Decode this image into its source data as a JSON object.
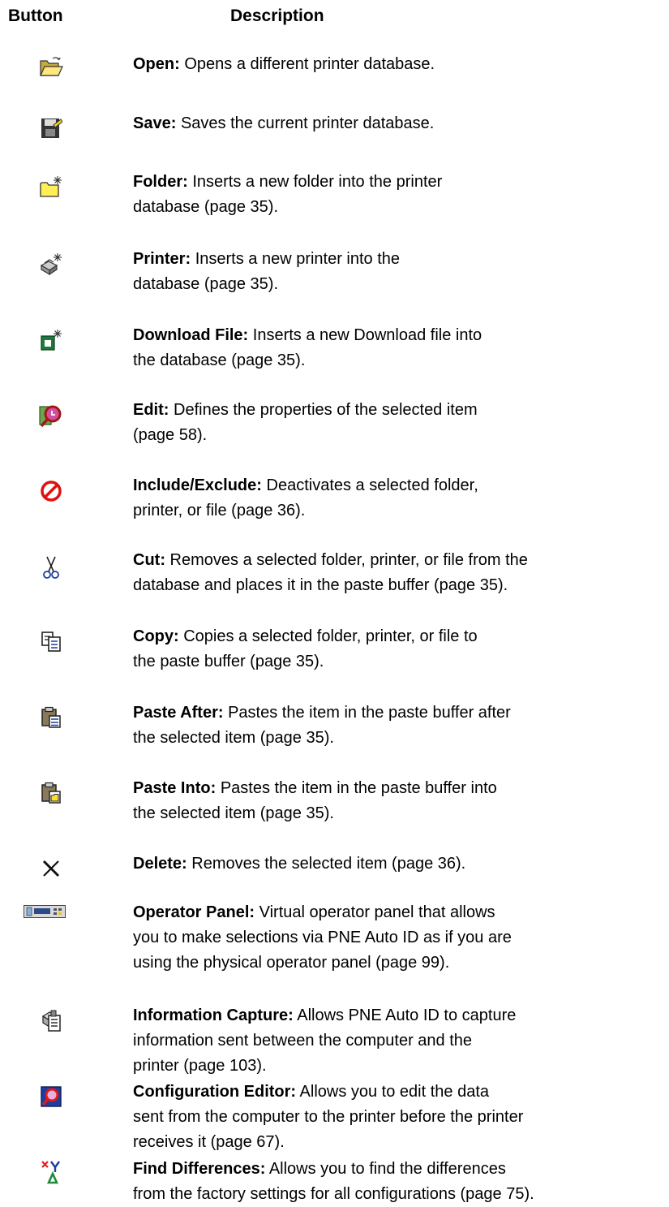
{
  "header": {
    "button": "Button",
    "description": "Description"
  },
  "rows": [
    {
      "icon": "open-folder-icon",
      "name": "Open:",
      "text": "Opens a different printer database."
    },
    {
      "icon": "save-icon",
      "name": "Save:",
      "text": "Saves the current printer database."
    },
    {
      "icon": "new-folder-icon",
      "name": "Folder:",
      "text": "Inserts a new folder into the printer\ndatabase (page 35)."
    },
    {
      "icon": "new-printer-icon",
      "name": "Printer:",
      "text": "Inserts a new printer into the\ndatabase (page 35)."
    },
    {
      "icon": "new-download-file-icon",
      "name": "Download File:",
      "text": "Inserts a new Download file into\nthe database (page 35)."
    },
    {
      "icon": "edit-properties-icon",
      "name": "Edit:",
      "text": "Defines the properties of the selected item\n(page 58)."
    },
    {
      "icon": "include-exclude-icon",
      "name": "Include/Exclude:",
      "text": "Deactivates a selected folder,\nprinter, or file (page 36)."
    },
    {
      "icon": "scissors-icon",
      "name": "Cut:",
      "text": "Removes a selected folder, printer, or file from the\ndatabase and places it in the paste buffer (page 35)."
    },
    {
      "icon": "copy-icon",
      "name": "Copy:",
      "text": "Copies a selected folder, printer, or file to\nthe paste buffer (page 35)."
    },
    {
      "icon": "paste-after-icon",
      "name": "Paste After:",
      "text": "Pastes the item in the paste buffer after\nthe selected item (page 35)."
    },
    {
      "icon": "paste-into-icon",
      "name": "Paste Into:",
      "text": "Pastes the item in the paste buffer into\nthe selected item (page 35)."
    },
    {
      "icon": "delete-icon",
      "name": "Delete:",
      "text": "Removes the selected item (page 36)."
    },
    {
      "icon": "operator-panel-icon",
      "name": "Operator Panel:",
      "text": "Virtual operator panel that allows\nyou to make selections via PNE Auto ID as if you are\nusing the physical operator panel (page 99)."
    },
    {
      "icon": "information-capture-icon",
      "name": "Information Capture:",
      "text": "Allows PNE Auto ID to capture\ninformation sent between the computer and the\nprinter (page 103)."
    },
    {
      "icon": "configuration-editor-icon",
      "name": "Configuration Editor:",
      "text": "Allows you to edit the data\nsent from the computer to the printer before the printer\nreceives it (page 67)."
    },
    {
      "icon": "find-differences-icon",
      "name": "Find Differences:",
      "text": "Allows you to find the differences\nfrom the factory settings for all configurations (page 75)."
    }
  ]
}
